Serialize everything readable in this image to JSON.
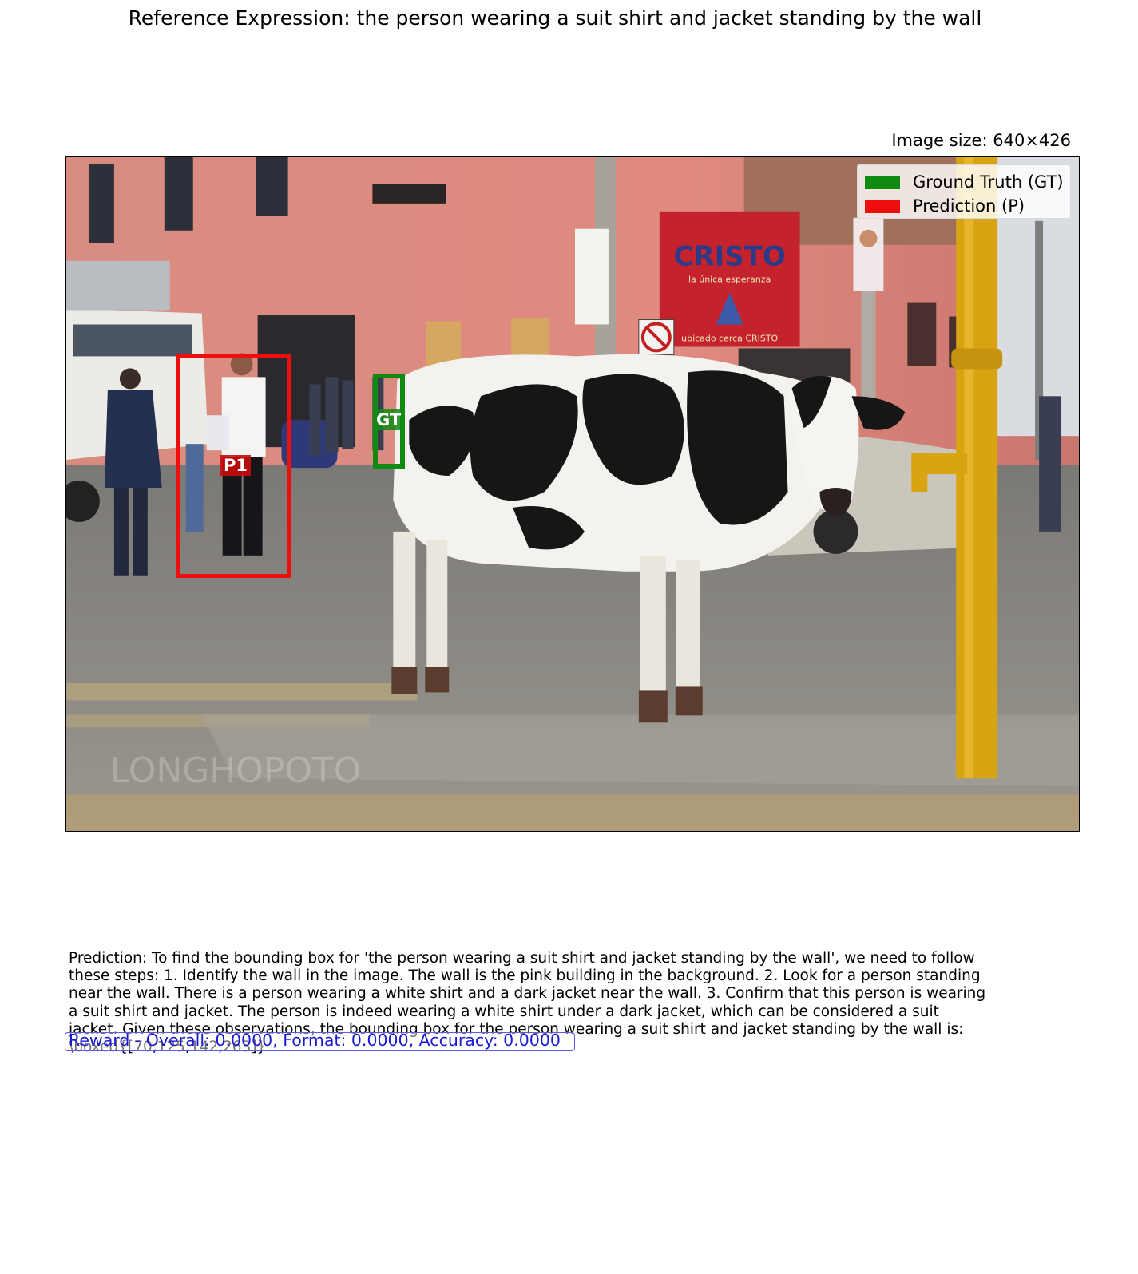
{
  "title": "Reference Expression: the person wearing a suit shirt and jacket standing by the wall",
  "image_size_label": "Image size: 640×426",
  "legend": {
    "items": [
      {
        "label": "Ground Truth (GT)",
        "color": "#118a11"
      },
      {
        "label": "Prediction (P)",
        "color": "#ef0e0e"
      }
    ]
  },
  "boxes": {
    "gt_label": "GT",
    "pred_label": "P1",
    "gt_color": "#118a11",
    "pred_color": "#ef0e0e"
  },
  "scene": {
    "sign_text": "CRISTO",
    "sign_subtext": "la única esperanza",
    "sign_bottom": "ubicado       cerca       CRISTO",
    "watermark": "LONGHOPOTO"
  },
  "prediction_text": "Prediction: To find the bounding box for 'the person wearing a suit shirt and jacket standing by the wall', we need to follow these steps:  1. Identify the wall in the image. The wall is the pink building in the background. 2. Look for a person standing near the wall. There is a person wearing a white shirt and a dark jacket near the wall. 3. Confirm that this person is wearing a suit shirt and jacket. The person is indeed wearing a white shirt under a dark jacket, which can be considered a suit jacket.  Given these observations, the bounding box for the person wearing a suit shirt and jacket standing by the wall is:  \\boxed{[70,125,142,263]}",
  "reward_text": "Reward - Overall: 0.0000, Format: 0.0000, Accuracy: 0.0000"
}
